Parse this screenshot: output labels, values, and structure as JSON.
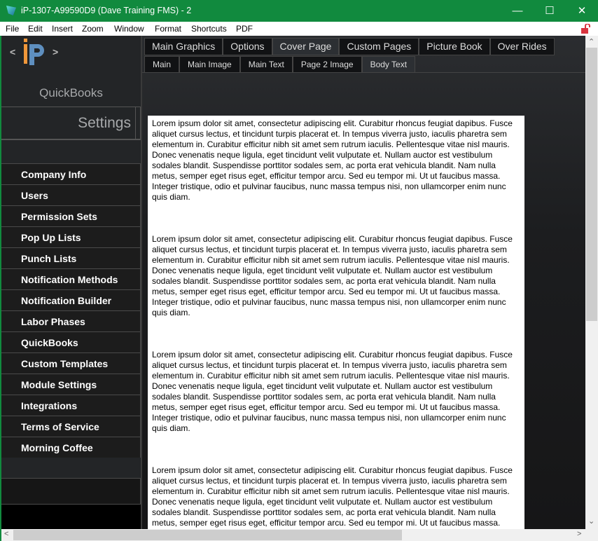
{
  "window": {
    "title": "iP-1307-A99590D9 (Dave Training FMS) - 2",
    "minimize": "—",
    "maximize": "☐",
    "close": "✕"
  },
  "menu": [
    "File",
    "Edit",
    "Insert",
    "Zoom",
    "Window",
    "Format",
    "Shortcuts",
    "PDF"
  ],
  "sidebar": {
    "prev": "<",
    "next": ">",
    "logo": "iP",
    "section": "QuickBooks",
    "heading": "Settings",
    "items": [
      "Company Info",
      "Users",
      "Permission Sets",
      "Pop Up Lists",
      "Punch Lists",
      "Notification Methods",
      "Notification Builder",
      "Labor Phases",
      "QuickBooks",
      "Custom Templates",
      "Module Settings",
      "Integrations",
      "Terms of Service",
      "Morning Coffee"
    ]
  },
  "tabs": [
    "Main Graphics",
    "Options",
    "Cover Page",
    "Custom Pages",
    "Picture Book",
    "Over Rides"
  ],
  "active_tab": "Cover Page",
  "subtabs": [
    "Main",
    "Main Image",
    "Main Text",
    "Page 2 Image",
    "Body Text"
  ],
  "active_subtab": "Body Text",
  "body_paragraphs": [
    "Lorem ipsum dolor sit amet, consectetur adipiscing elit. Curabitur rhoncus feugiat dapibus. Fusce aliquet cursus lectus, et tincidunt turpis placerat et. In tempus viverra justo, iaculis pharetra sem elementum in. Curabitur efficitur nibh sit amet sem rutrum iaculis. Pellentesque vitae nisl mauris. Donec venenatis neque ligula, eget tincidunt velit vulputate et. Nullam auctor est vestibulum sodales blandit. Suspendisse porttitor sodales sem, ac porta erat vehicula blandit. Nam nulla metus, semper eget risus eget, efficitur tempor arcu. Sed eu tempor mi. Ut ut faucibus massa. Integer tristique, odio et pulvinar faucibus, nunc massa tempus nisi, non ullamcorper enim nunc quis diam.",
    "Lorem ipsum dolor sit amet, consectetur adipiscing elit. Curabitur rhoncus feugiat dapibus. Fusce aliquet cursus lectus, et tincidunt turpis placerat et. In tempus viverra justo, iaculis pharetra sem elementum in. Curabitur efficitur nibh sit amet sem rutrum iaculis. Pellentesque vitae nisl mauris. Donec venenatis neque ligula, eget tincidunt velit vulputate et. Nullam auctor est vestibulum sodales blandit. Suspendisse porttitor sodales sem, ac porta erat vehicula blandit. Nam nulla metus, semper eget risus eget, efficitur tempor arcu. Sed eu tempor mi. Ut ut faucibus massa. Integer tristique, odio et pulvinar faucibus, nunc massa tempus nisi, non ullamcorper enim nunc quis diam.",
    "Lorem ipsum dolor sit amet, consectetur adipiscing elit. Curabitur rhoncus feugiat dapibus. Fusce aliquet cursus lectus, et tincidunt turpis placerat et. In tempus viverra justo, iaculis pharetra sem elementum in. Curabitur efficitur nibh sit amet sem rutrum iaculis. Pellentesque vitae nisl mauris. Donec venenatis neque ligula, eget tincidunt velit vulputate et. Nullam auctor est vestibulum sodales blandit. Suspendisse porttitor sodales sem, ac porta erat vehicula blandit. Nam nulla metus, semper eget risus eget, efficitur tempor arcu. Sed eu tempor mi. Ut ut faucibus massa. Integer tristique, odio et pulvinar faucibus, nunc massa tempus nisi, non ullamcorper enim nunc quis diam.",
    "Lorem ipsum dolor sit amet, consectetur adipiscing elit. Curabitur rhoncus feugiat dapibus. Fusce aliquet cursus lectus, et tincidunt turpis placerat et. In tempus viverra justo, iaculis pharetra sem elementum in. Curabitur efficitur nibh sit amet sem rutrum iaculis. Pellentesque vitae nisl mauris. Donec venenatis neque ligula, eget tincidunt velit vulputate et. Nullam auctor est vestibulum sodales blandit. Suspendisse porttitor sodales sem, ac porta erat vehicula blandit. Nam nulla metus, semper eget risus eget, efficitur tempor arcu. Sed eu tempor mi. Ut ut faucibus massa. Integer tristique, odio et pulvinar faucibus, nunc massa tempus nisi, non ullamcorper enim nunc quis diam."
  ],
  "colors": {
    "titlebar": "#118a3e",
    "lock": "#d9343f"
  }
}
